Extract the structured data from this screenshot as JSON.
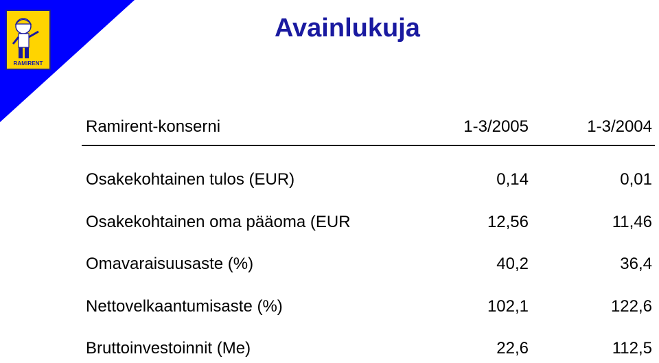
{
  "logo": {
    "brand": "RAMIRENT",
    "mascot_label": "RAMI"
  },
  "title": "Avainlukuja",
  "colors": {
    "corner": "#0000ff",
    "title": "#1a1aa0",
    "logo_bg": "#ffd400"
  },
  "table": {
    "header": {
      "label": "Ramirent-konserni",
      "col1": "1-3/2005",
      "col2": "1-3/2004"
    },
    "rows": [
      {
        "label": "Osakekohtainen tulos (EUR)",
        "col1": "0,14",
        "col2": "0,01"
      },
      {
        "label": "Osakekohtainen oma pääoma (EUR",
        "col1": "12,56",
        "col2": "11,46"
      },
      {
        "label": "Omavaraisuusaste (%)",
        "col1": "40,2",
        "col2": "36,4"
      },
      {
        "label": "Nettovelkaantumisaste (%)",
        "col1": "102,1",
        "col2": "122,6"
      },
      {
        "label": "Bruttoinvestoinnit (Me)",
        "col1": "22,6",
        "col2": "112,5"
      }
    ]
  }
}
